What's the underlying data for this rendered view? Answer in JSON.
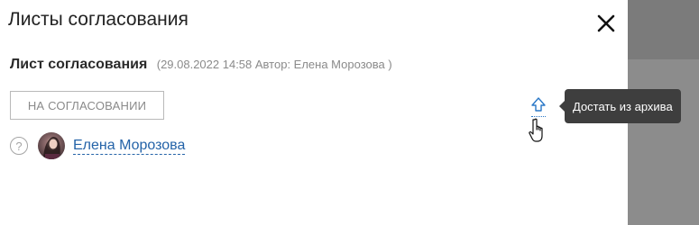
{
  "panel": {
    "title": "Листы согласования",
    "close_icon": "close-icon"
  },
  "sheet": {
    "title": "Лист согласования",
    "meta": "(29.08.2022 14:58 Автор: Елена Морозова )",
    "status": "НА СОГЛАСОВАНИИ",
    "unarchive_icon": "upload-arrow-icon"
  },
  "tooltip": {
    "text": "Достать из архива"
  },
  "approver": {
    "status_icon": "question-icon",
    "status_glyph": "?",
    "name": "Елена Морозова"
  },
  "colors": {
    "link": "#2463a8",
    "backdrop": "#8c8c8c",
    "tooltip_bg": "#3e3e3e"
  }
}
